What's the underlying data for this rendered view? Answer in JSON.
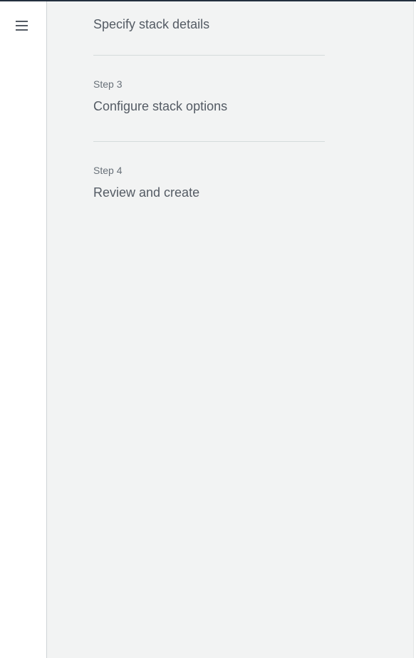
{
  "nav": {
    "menu_icon": "hamburger-menu-icon"
  },
  "steps": [
    {
      "title": "Specify stack details"
    },
    {
      "label": "Step 3",
      "title": "Configure stack options"
    },
    {
      "label": "Step 4",
      "title": "Review and create"
    }
  ],
  "colors": {
    "panel_background": "#f2f3f3",
    "step_title": "#545b64",
    "step_label": "#687078",
    "divider": "#d5dbdb",
    "top_border": "#232f3e"
  }
}
